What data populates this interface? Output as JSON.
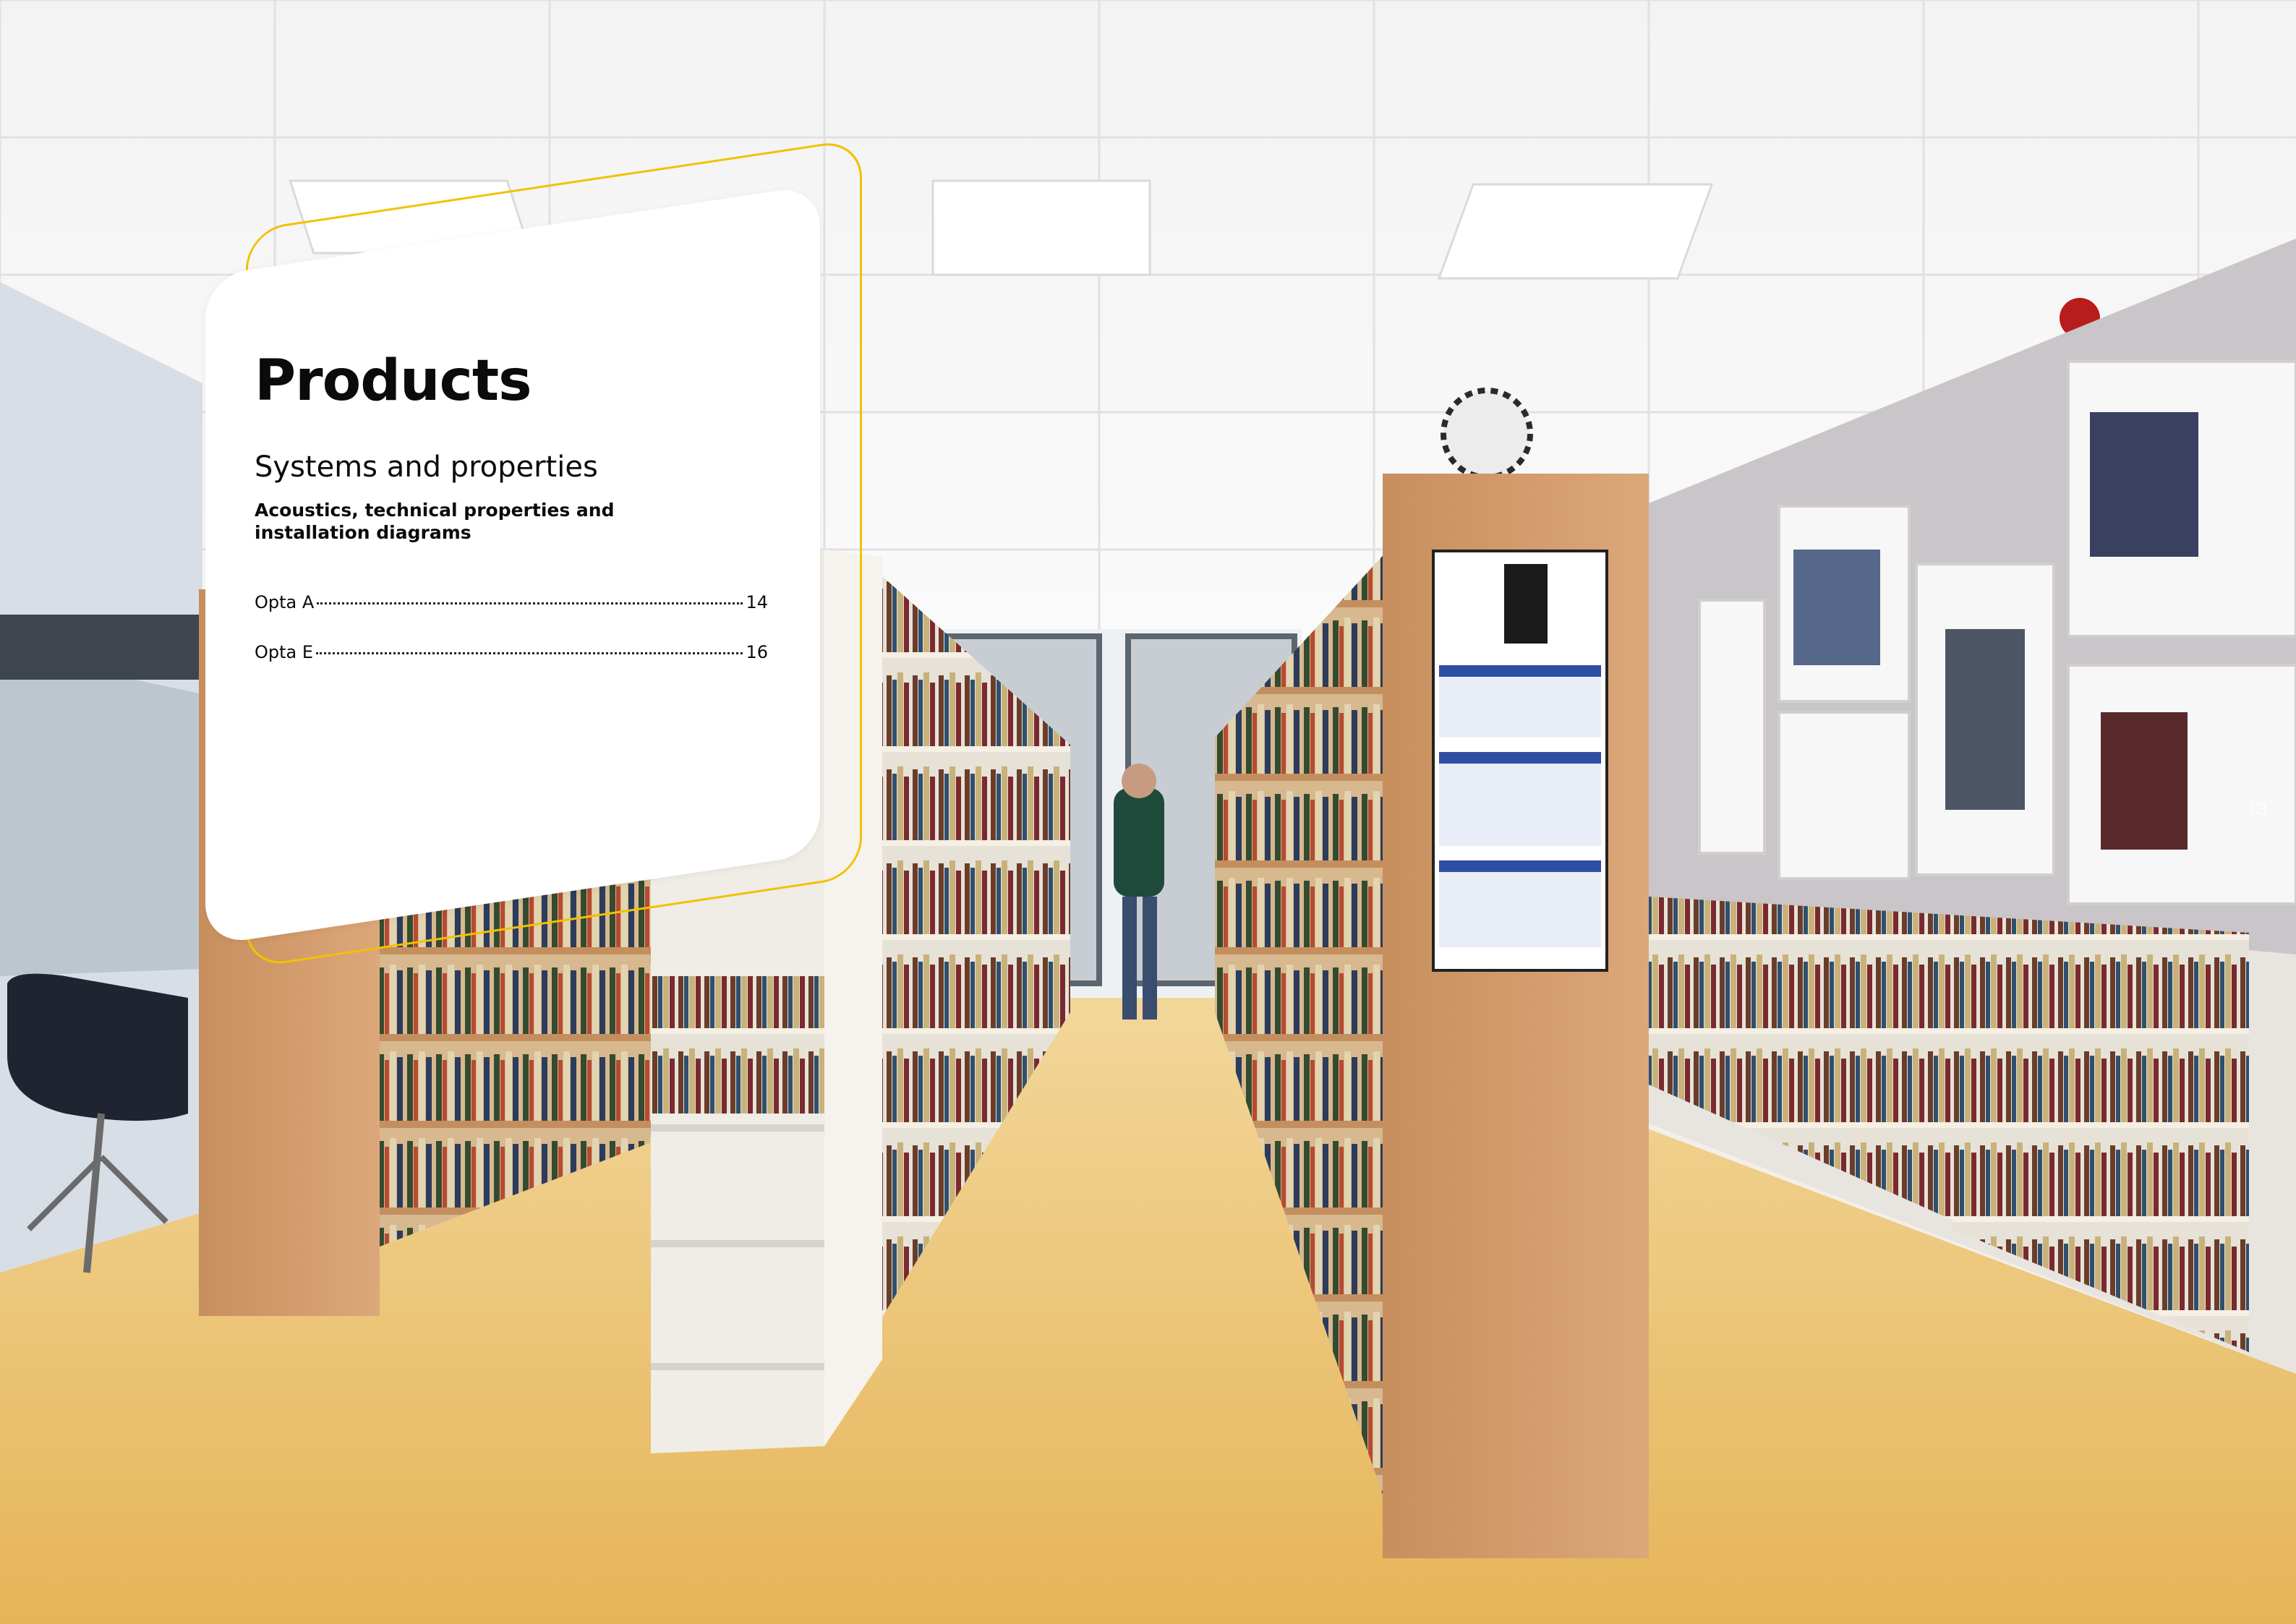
{
  "card": {
    "title": "Products",
    "subtitle": "Systems and properties",
    "description": "Acoustics, technical properties and installation diagrams"
  },
  "toc": [
    {
      "label": "Opta A",
      "page": "14"
    },
    {
      "label": "Opta E",
      "page": "16"
    }
  ],
  "page_number": "13",
  "colors": {
    "accent_outline": "#f2c100",
    "card_background": "#ffffff",
    "text": "#0b0b0b"
  }
}
